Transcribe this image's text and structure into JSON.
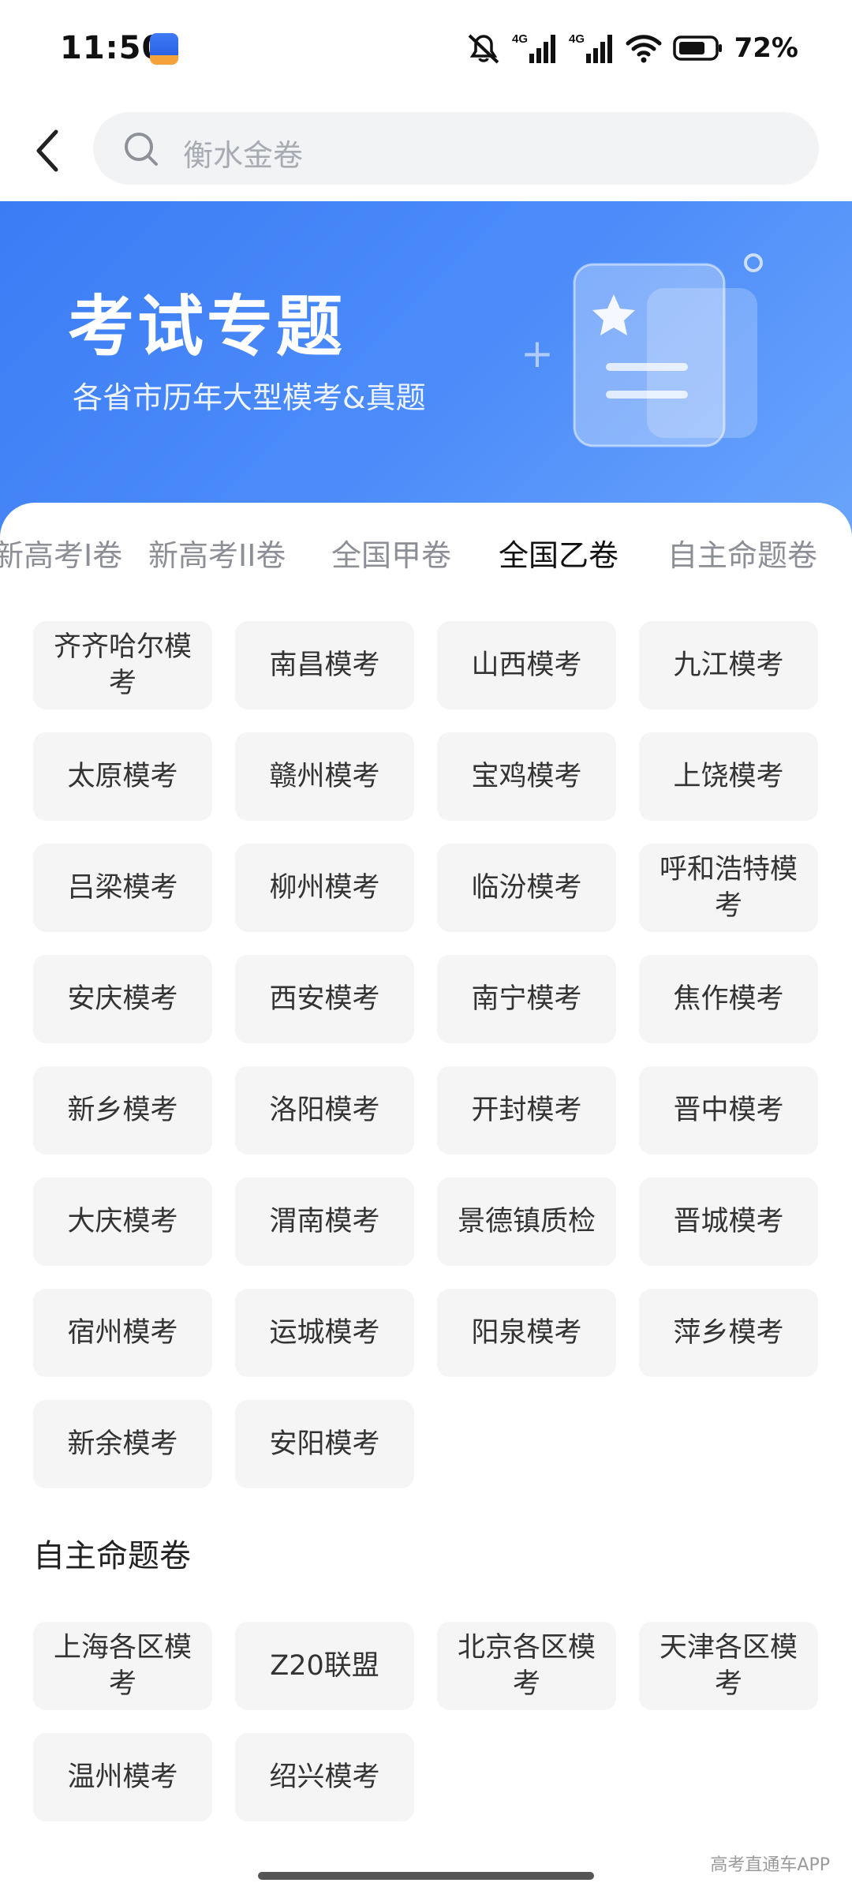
{
  "status_bar": {
    "time": "11:50",
    "network_1": "4G",
    "network_2": "4G",
    "battery": "72%"
  },
  "search": {
    "placeholder": "衡水金卷"
  },
  "banner": {
    "title": "考试专题",
    "subtitle": "各省市历年大型模考&真题"
  },
  "tabs": [
    {
      "label": "新高考I卷",
      "active": false
    },
    {
      "label": "新高考II卷",
      "active": false
    },
    {
      "label": "全国甲卷",
      "active": false
    },
    {
      "label": "全国乙卷",
      "active": true
    },
    {
      "label": "自主命题卷",
      "active": false
    }
  ],
  "exams": [
    "齐齐哈尔模考",
    "南昌模考",
    "山西模考",
    "九江模考",
    "太原模考",
    "赣州模考",
    "宝鸡模考",
    "上饶模考",
    "吕梁模考",
    "柳州模考",
    "临汾模考",
    "呼和浩特模考",
    "安庆模考",
    "西安模考",
    "南宁模考",
    "焦作模考",
    "新乡模考",
    "洛阳模考",
    "开封模考",
    "晋中模考",
    "大庆模考",
    "渭南模考",
    "景德镇质检",
    "晋城模考",
    "宿州模考",
    "运城模考",
    "阳泉模考",
    "萍乡模考",
    "新余模考",
    "安阳模考"
  ],
  "section_independent": {
    "title": "自主命题卷",
    "items": [
      "上海各区模考",
      "Z20联盟",
      "北京各区模考",
      "天津各区模考",
      "温州模考",
      "绍兴模考"
    ]
  },
  "watermark": "高考直通车APP",
  "colors": {
    "accent": "#3b7cf5",
    "chip_bg": "#f5f5f6",
    "tab_inactive": "#8c8f96"
  }
}
